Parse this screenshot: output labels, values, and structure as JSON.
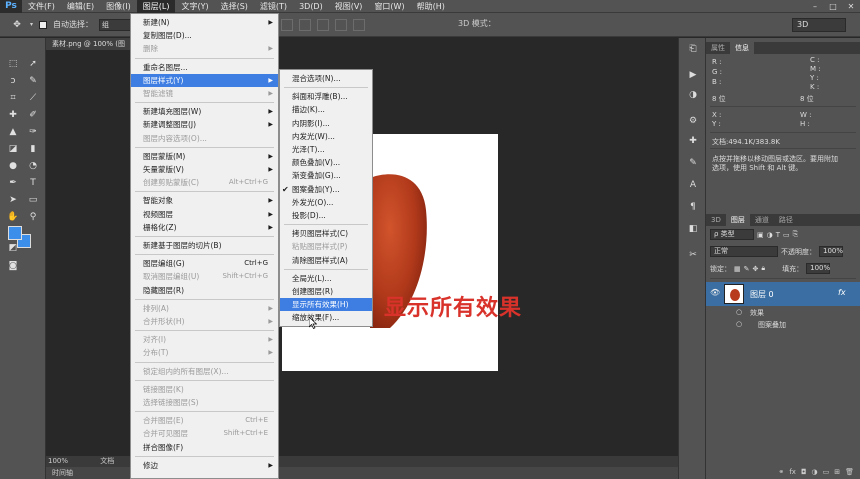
{
  "app": {
    "logo": "Ps"
  },
  "menubar": {
    "items": [
      "文件(F)",
      "编辑(E)",
      "图像(I)",
      "图层(L)",
      "文字(Y)",
      "选择(S)",
      "滤镜(T)",
      "3D(D)",
      "视图(V)",
      "窗口(W)",
      "帮助(H)"
    ],
    "active_index": 3
  },
  "options": {
    "auto_select": "自动选择：",
    "auto_select_value": "组",
    "mode_3d": "3D 模式：",
    "workspace": "3D"
  },
  "document": {
    "tab_title": "素材.png @ 100% (图",
    "annotation": "显示所有效果",
    "zoom": "100%",
    "status_label": "文档",
    "timeline_tab": "时间轴"
  },
  "info_panel": {
    "tabs": [
      "属性",
      "信息"
    ],
    "active_tab": 1,
    "r": "R :",
    "g": "G :",
    "b": "B :",
    "c": "C :",
    "m": "M :",
    "y": "Y :",
    "k": "K :",
    "bits1": "8 位",
    "bits2": "8 位",
    "x": "X :",
    "y_coord": "Y :",
    "w": "W :",
    "h": "H :",
    "doc": "文档:494.1K/383.8K",
    "hint1": "点按并拖移以移动图层或选区。要用附加",
    "hint2": "选项，使用 Shift 和 Alt 键。"
  },
  "layers_panel": {
    "tabs": [
      "3D",
      "图层",
      "通道",
      "路径"
    ],
    "active_tab": 1,
    "filter_type": "ρ 类型",
    "blend_mode": "正常",
    "opacity_label": "不透明度：",
    "opacity_value": "100%",
    "lock_label": "锁定：",
    "fill_label": "填充：",
    "fill_value": "100%",
    "layer_name": "图层 0",
    "fx": "fx",
    "effects_label": "效果",
    "effect_item": "图案叠加"
  },
  "layer_menu": [
    {
      "label": "新建(N)",
      "arrow": true
    },
    {
      "label": "复制图层(D)..."
    },
    {
      "label": "删除",
      "disabled": true,
      "arrow": true
    },
    {
      "sep": true
    },
    {
      "label": "重命名图层..."
    },
    {
      "label": "图层样式(Y)",
      "arrow": true,
      "highlight": true
    },
    {
      "label": "智能滤镜",
      "disabled": true,
      "arrow": true
    },
    {
      "sep": true
    },
    {
      "label": "新建填充图层(W)",
      "arrow": true
    },
    {
      "label": "新建调整图层(J)",
      "arrow": true
    },
    {
      "label": "图层内容选项(O)...",
      "disabled": true
    },
    {
      "sep": true
    },
    {
      "label": "图层蒙版(M)",
      "arrow": true
    },
    {
      "label": "矢量蒙版(V)",
      "arrow": true
    },
    {
      "label": "创建剪贴蒙版(C)",
      "shortcut": "Alt+Ctrl+G",
      "disabled": true
    },
    {
      "sep": true
    },
    {
      "label": "智能对象",
      "arrow": true
    },
    {
      "label": "视频图层",
      "arrow": true
    },
    {
      "label": "栅格化(Z)",
      "arrow": true
    },
    {
      "sep": true
    },
    {
      "label": "新建基于图层的切片(B)"
    },
    {
      "sep": true
    },
    {
      "label": "图层编组(G)",
      "shortcut": "Ctrl+G"
    },
    {
      "label": "取消图层编组(U)",
      "shortcut": "Shift+Ctrl+G",
      "disabled": true
    },
    {
      "label": "隐藏图层(R)"
    },
    {
      "sep": true
    },
    {
      "label": "排列(A)",
      "disabled": true,
      "arrow": true
    },
    {
      "label": "合并形状(H)",
      "disabled": true,
      "arrow": true
    },
    {
      "sep": true
    },
    {
      "label": "对齐(I)",
      "disabled": true,
      "arrow": true
    },
    {
      "label": "分布(T)",
      "disabled": true,
      "arrow": true
    },
    {
      "sep": true
    },
    {
      "label": "锁定组内的所有图层(X)...",
      "disabled": true
    },
    {
      "sep": true
    },
    {
      "label": "链接图层(K)",
      "disabled": true
    },
    {
      "label": "选择链接图层(S)",
      "disabled": true
    },
    {
      "sep": true
    },
    {
      "label": "合并图层(E)",
      "shortcut": "Ctrl+E",
      "disabled": true
    },
    {
      "label": "合并可见图层",
      "shortcut": "Shift+Ctrl+E",
      "disabled": true
    },
    {
      "label": "拼合图像(F)"
    },
    {
      "sep": true
    },
    {
      "label": "修边",
      "arrow": true
    }
  ],
  "style_submenu": [
    {
      "label": "混合选项(N)..."
    },
    {
      "sep": true
    },
    {
      "label": "斜面和浮雕(B)..."
    },
    {
      "label": "描边(K)..."
    },
    {
      "label": "内阴影(I)..."
    },
    {
      "label": "内发光(W)..."
    },
    {
      "label": "光泽(T)..."
    },
    {
      "label": "颜色叠加(V)..."
    },
    {
      "label": "渐变叠加(G)..."
    },
    {
      "label": "图案叠加(Y)...",
      "check": true
    },
    {
      "label": "外发光(O)..."
    },
    {
      "label": "投影(D)..."
    },
    {
      "sep": true
    },
    {
      "label": "拷贝图层样式(C)"
    },
    {
      "label": "粘贴图层样式(P)",
      "disabled": true
    },
    {
      "label": "清除图层样式(A)"
    },
    {
      "sep": true
    },
    {
      "label": "全局光(L)..."
    },
    {
      "label": "创建图层(R)"
    },
    {
      "label": "显示所有效果(H)",
      "highlight": true
    },
    {
      "label": "缩放效果(F)..."
    }
  ],
  "colors": {
    "accent": "#3e7ee3",
    "annotation": "#d8322a",
    "apple": "#b73a1c",
    "foreground": "#3b8eea"
  }
}
